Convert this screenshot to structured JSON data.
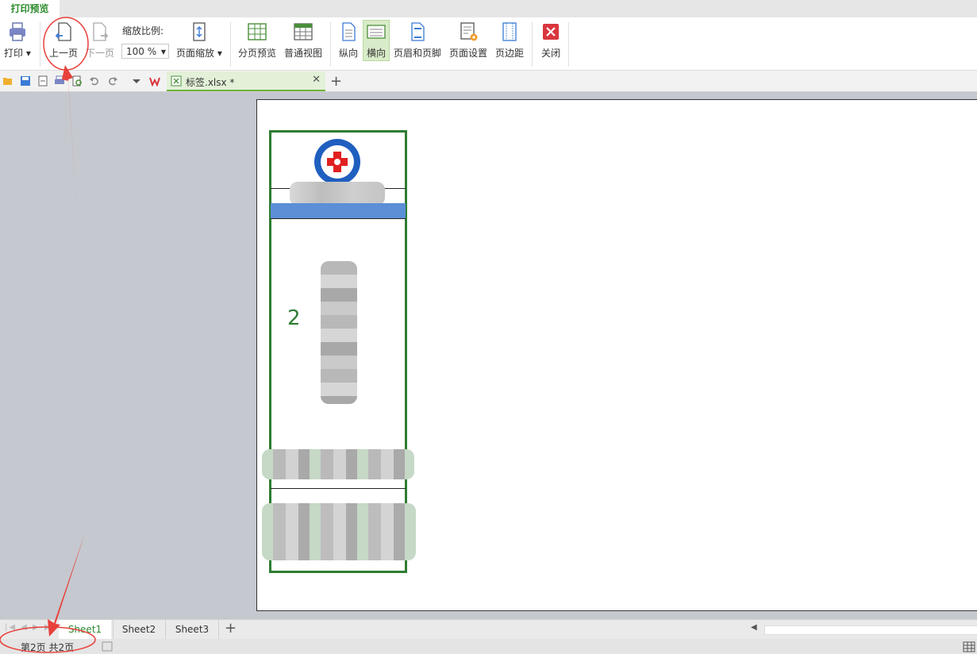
{
  "tab": {
    "label": "打印预览"
  },
  "toolbar": {
    "print": "打印",
    "prev_page": "上一页",
    "next_page": "下一页",
    "zoom_label": "缩放比例:",
    "zoom_value": "100 %",
    "page_zoom": "页面缩放",
    "page_break_preview": "分页预览",
    "normal_view": "普通视图",
    "portrait": "纵向",
    "landscape": "横向",
    "header_footer": "页眉和页脚",
    "page_setup": "页面设置",
    "margins": "页边距",
    "close": "关闭"
  },
  "document_tab": {
    "name": "标签.xlsx *"
  },
  "preview": {
    "page_number_text": "2"
  },
  "sheets": [
    "Sheet1",
    "Sheet2",
    "Sheet3"
  ],
  "status": {
    "page_info": "第2页 共2页"
  },
  "colors": {
    "accent": "#2e8b2e",
    "label_border": "#2e7d32",
    "blue_bar": "#5b8fd6",
    "annotation": "#e8413c"
  },
  "icons": [
    "printer-icon",
    "prev-page-icon",
    "next-page-icon",
    "page-zoom-icon",
    "page-break-preview-icon",
    "normal-view-icon",
    "portrait-icon",
    "landscape-icon",
    "header-footer-icon",
    "page-setup-icon",
    "margins-icon",
    "close-icon",
    "open-folder-icon",
    "save-icon",
    "undo-icon",
    "redo-icon",
    "wps-logo-icon",
    "excel-file-icon"
  ]
}
